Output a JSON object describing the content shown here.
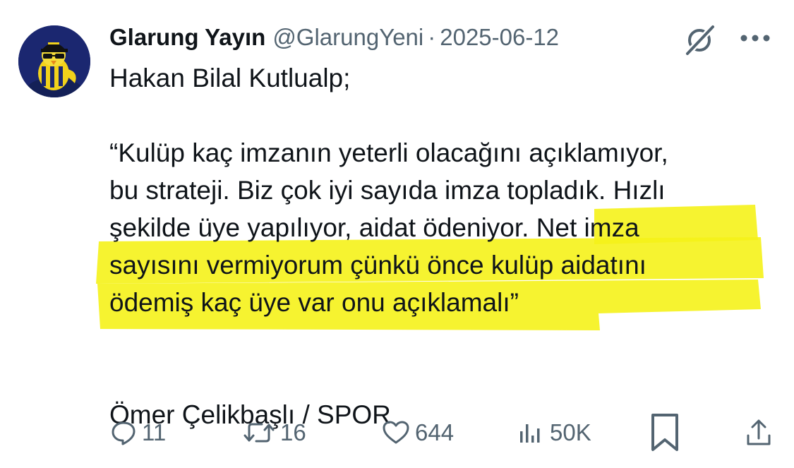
{
  "tweet": {
    "author_name": "Glarung Yayın",
    "author_handle": "@GlarungYeni",
    "separator": "·",
    "date": "2025-06-12",
    "avatar_icon": "avatar-canary-mascot",
    "grok_icon": "grok-icon",
    "more_icon": "more-icon",
    "body_lines": [
      "Hakan Bilal Kutlualp;",
      "“Kulüp kaç imzanın yeterli olacağını açıklamıyor,",
      "bu strateji. Biz çok iyi sayıda imza topladık. Hızlı",
      "şekilde üye yapılıyor, aidat ödeniyor. Net imza",
      "sayısını vermiyorum çünkü önce kulüp aidatını",
      "ödemiş kaç üye var onu açıklamalı”",
      "Ömer Çelikbaşlı / SPOR"
    ],
    "highlight_color": "#f5f21a",
    "accent_color": "#1d9bf0",
    "text_color": "#0f1419",
    "muted_color": "#536471"
  },
  "actions": {
    "replies": "11",
    "reposts": "16",
    "likes": "644",
    "views": "50K"
  }
}
